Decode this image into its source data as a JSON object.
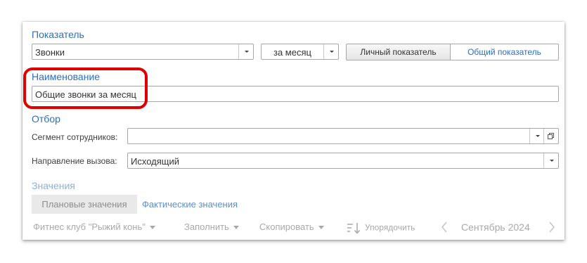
{
  "sections": {
    "indicator": "Показатель",
    "name": "Наименование",
    "filter": "Отбор",
    "values": "Значения"
  },
  "indicator": {
    "type_value": "Звонки",
    "period_value": "за месяц",
    "toggle": {
      "personal": "Личный показатель",
      "common": "Общий показатель",
      "selected": "personal"
    }
  },
  "name_field": {
    "value": "Общие звонки за месяц"
  },
  "filter": {
    "segment_label": "Сегмент сотрудников:",
    "segment_value": "",
    "direction_label": "Направление вызова:",
    "direction_value": "Исходящий"
  },
  "value_tabs": {
    "planned": "Плановые значения",
    "actual": "Фактические значения",
    "selected": "planned"
  },
  "toolbar": {
    "club": "Фитнес клуб \"Рыжий конь\"",
    "fill": "Заполнить",
    "copy": "Скопировать",
    "sort": "Упорядочить",
    "period": "Сентябрь 2024"
  }
}
